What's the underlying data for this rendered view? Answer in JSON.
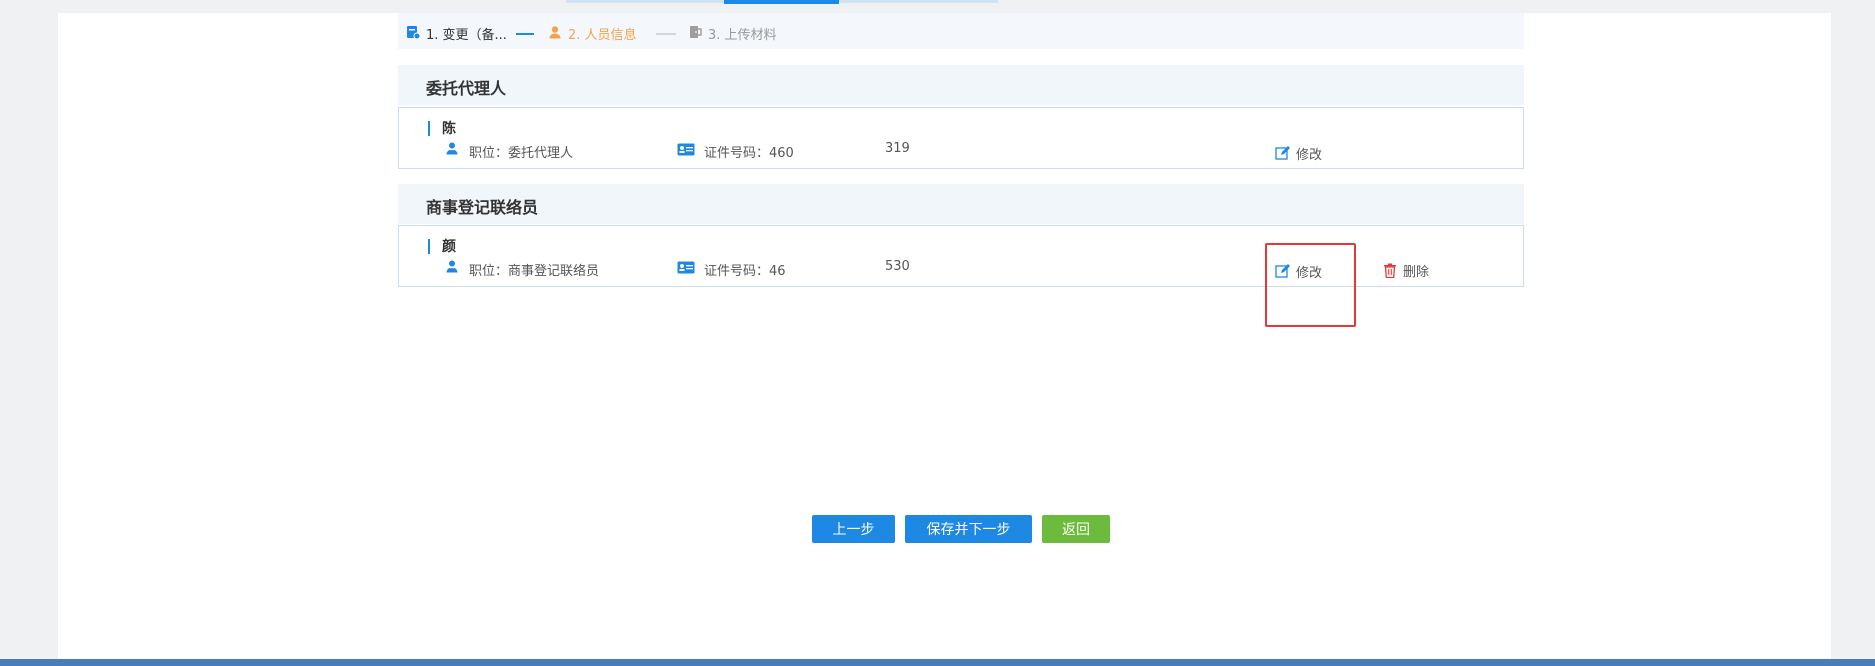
{
  "steps": [
    {
      "label": "1. 变更（备...",
      "state": "done",
      "icon": "form-icon"
    },
    {
      "label": "2. 人员信息",
      "state": "active",
      "icon": "person-icon"
    },
    {
      "label": "3. 上传材料",
      "state": "pending",
      "icon": "door-icon"
    }
  ],
  "sections": [
    {
      "title": "委托代理人",
      "person": {
        "name": "陈",
        "position": "职位：委托代理人",
        "id_label": "证件号码：460",
        "id_tail": "319",
        "edit_label": "修改"
      }
    },
    {
      "title": "商事登记联络员",
      "person": {
        "name": "颜",
        "position": "职位：商事登记联络员",
        "id_label": "证件号码：46",
        "id_tail": "530",
        "edit_label": "修改",
        "delete_label": "删除"
      }
    }
  ],
  "buttons": {
    "prev": "上一步",
    "save_next": "保存并下一步",
    "back": "返回"
  },
  "colors": {
    "accent": "#1e88e5",
    "active_step": "#f5a34a",
    "success": "#6cbb3c",
    "danger": "#e53935"
  }
}
